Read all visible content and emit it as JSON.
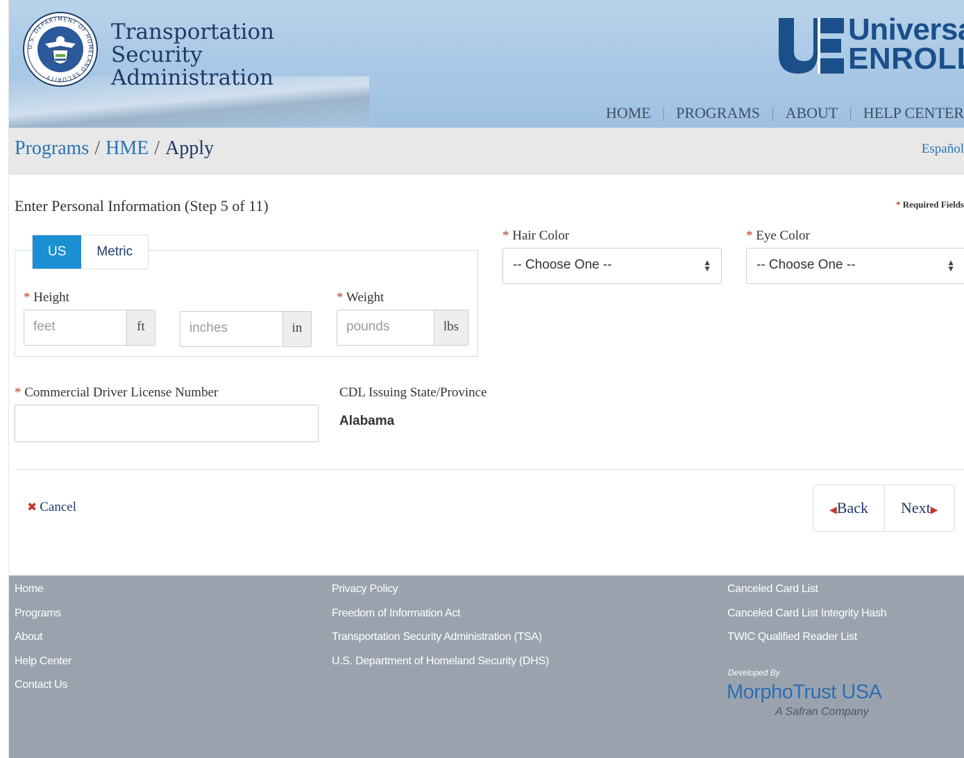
{
  "header": {
    "agency_line1": "Transportation",
    "agency_line2": "Security",
    "agency_line3": "Administration",
    "seal_text": "U.S. DEPARTMENT OF HOMELAND SECURITY",
    "ue_line1": "Universal",
    "ue_line2": "ENROLL",
    "nav": [
      "HOME",
      "PROGRAMS",
      "ABOUT",
      "HELP CENTER"
    ]
  },
  "breadcrumb": {
    "items": [
      "Programs",
      "HME"
    ],
    "current": "Apply",
    "separator": "/",
    "language_link": "Español"
  },
  "form": {
    "title": "Enter Personal Information (Step 5 of 11)",
    "required_note": "Required Fields",
    "required_marker": "*",
    "unit_tabs": [
      "US",
      "Metric"
    ],
    "active_unit_tab": "US",
    "height_label": "Height",
    "feet_placeholder": "feet",
    "feet_unit": "ft",
    "inches_placeholder": "inches",
    "inches_unit": "in",
    "weight_label": "Weight",
    "weight_placeholder": "pounds",
    "weight_unit": "lbs",
    "hair_label": "Hair Color",
    "hair_value": "-- Choose One --",
    "eye_label": "Eye Color",
    "eye_value": "-- Choose One --",
    "cdl_label": "Commercial Driver License Number",
    "cdl_value": "",
    "cdl_state_label": "CDL Issuing State/Province",
    "cdl_state_value": "Alabama",
    "cancel_label": "Cancel",
    "back_label": "Back",
    "next_label": "Next"
  },
  "footer": {
    "col1": [
      "Home",
      "Programs",
      "About",
      "Help Center",
      "Contact Us"
    ],
    "col2": [
      "Privacy Policy",
      "Freedom of Information Act",
      "Transportation Security Administration (TSA)",
      "U.S. Department of Homeland Security (DHS)"
    ],
    "col3": [
      "Canceled Card List",
      "Canceled Card List Integrity Hash",
      "TWIC Qualified Reader List"
    ],
    "developed_by": "Developed By",
    "company": "MorphoTrust USA",
    "company_tagline": "A Safran Company"
  },
  "colors": {
    "primary_blue": "#1a8fd1",
    "link_blue": "#2a72b5",
    "navy": "#1d3a67",
    "required_red": "#c0392b",
    "footer_gray": "#9aa3ad"
  },
  "icons": {
    "select_arrow": "up-down-caret-icon",
    "cancel": "x-icon",
    "back": "caret-left-icon",
    "next": "caret-right-icon"
  }
}
